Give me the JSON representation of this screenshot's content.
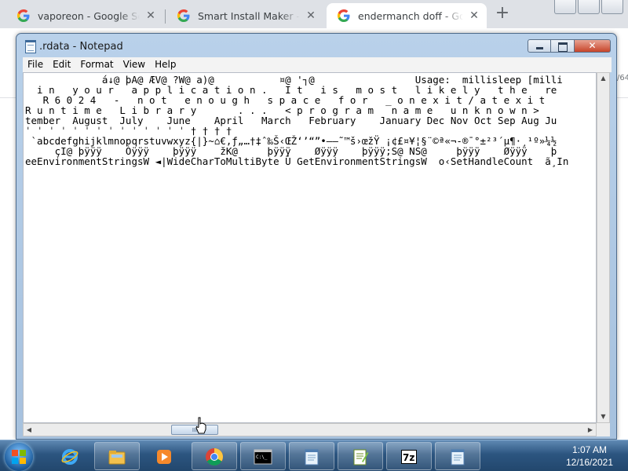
{
  "browser": {
    "tabs": [
      {
        "title": "vaporeon - Google Search",
        "active": false
      },
      {
        "title": "Smart Install Maker - creat",
        "active": false
      },
      {
        "title": "endermanch doff - Googl",
        "active": true
      }
    ],
    "new_tab_label": "+",
    "close_label": "✕",
    "background_fragment": "/64"
  },
  "notepad": {
    "title": ".rdata - Notepad",
    "menu": [
      "File",
      "Edit",
      "Format",
      "View",
      "Help"
    ],
    "close_label": "✕",
    "lines": [
      "             á↓@ þA@ ÆV@ ?W@ a)@           ¤@ '┐@                 Usage:  millisleep [milli",
      "  i n   y o u r   a p p l i c a t i o n .   I t   i s   m o s t   l i k e l y   t h e   re",
      "   R 6 0 2 4   -   n o t   e n o u g h   s p a c e   f o r   _ o n e x i t / a t e x i t",
      "R u n t i m e   L i b r a r y       . . .   < p r o g r a m   n a m e   u n k n o w n >",
      "tember  August  July    June    April   March   February    January Dec Nov Oct Sep Aug Ju",
      "ˈ ˈ ˈ ˈ ˈ ˈ ˈ ˈ ˈ ˈ ˈ ˈ ˈ ˈ † † † †",
      " `abcdefghijklmnopqrstuvwxyz{|}~⌂€‚ƒ„…†‡ˆ‰Š‹ŒŽ‘’“”•–—˜™š›œžŸ ¡¢£¤¥¦§¨©ª«¬-®¯°±²³´µ¶·¸¹º»¼½",
      "     çI@ þÿÿÿ    Òÿÿÿ    þÿÿÿ    žK@     þÿÿÿ    Øÿÿÿ    þÿÿÿ;S@ NS@     þÿÿÿ    Øÿÿÿ    þ",
      "eeEnvironmentStringsW ◄|WideCharToMultiByte Ú GetEnvironmentStringsW  o‹SetHandleCount  ã¸In"
    ],
    "hscroll_thumb_label": "III"
  },
  "taskbar": {
    "items": [
      "internet-explorer",
      "windows-explorer",
      "media-player",
      "chrome",
      "command-prompt",
      "notepad",
      "notepad-plus-plus",
      "7-zip",
      "notepad"
    ],
    "time": "1:07 AM",
    "date": "12/16/2021"
  }
}
